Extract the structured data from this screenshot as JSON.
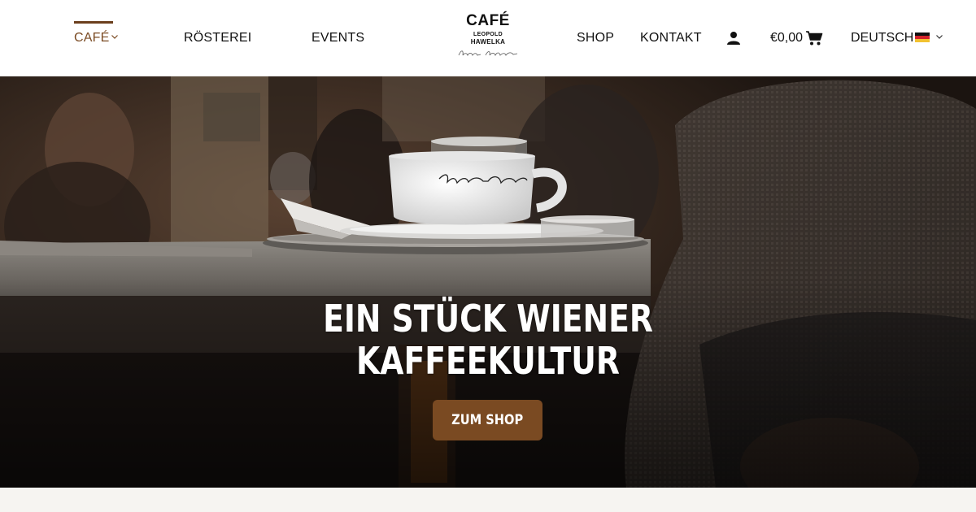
{
  "nav": {
    "cafe_label": "CAFÉ",
    "roesterei_label": "RÖSTEREI",
    "events_label": "EVENTS",
    "shop_label": "SHOP",
    "kontakt_label": "KONTAKT"
  },
  "logo": {
    "title": "CAFÉ",
    "line1": "LEOPOLD",
    "line2": "HAWELKA"
  },
  "cart": {
    "amount": "€0,00"
  },
  "language": {
    "current": "DEUTSCH"
  },
  "hero": {
    "title_line1": "EIN STÜCK WIENER",
    "title_line2": "KAFFEEKULTUR",
    "button_label": "ZUM SHOP"
  },
  "icons": {
    "user": "user-icon",
    "cart": "shopping-cart-icon",
    "chevron": "chevron-down-icon",
    "flag": "german-flag-icon"
  },
  "colors": {
    "accent_brown": "#7a4a22",
    "active_nav_bar": "#6b3f1d",
    "header_bg": "#ffffff",
    "hero_text": "#ffffff"
  }
}
